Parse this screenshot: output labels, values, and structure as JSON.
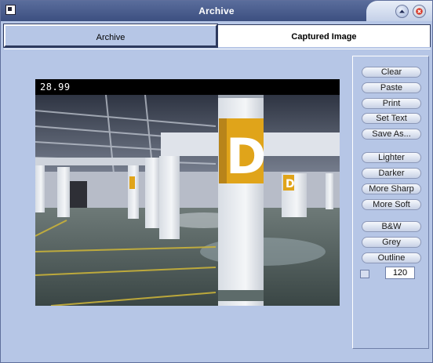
{
  "window": {
    "title": "Archive"
  },
  "tabs": [
    {
      "label": "Archive",
      "active": false
    },
    {
      "label": "Captured Image",
      "active": true
    }
  ],
  "image": {
    "overlay_text": "28.99"
  },
  "panel": {
    "buttons_group1": [
      "Clear",
      "Paste",
      "Print",
      "Set Text",
      "Save As..."
    ],
    "buttons_group2": [
      "Lighter",
      "Darker",
      "More Sharp",
      "More Soft"
    ],
    "buttons_group3": [
      "B&W",
      "Grey",
      "Outline"
    ],
    "value_field": "120"
  },
  "colors": {
    "window_bg": "#b6c6e6",
    "titlebar": "#4a5d8e",
    "sign_yellow": "#e0a41a"
  }
}
